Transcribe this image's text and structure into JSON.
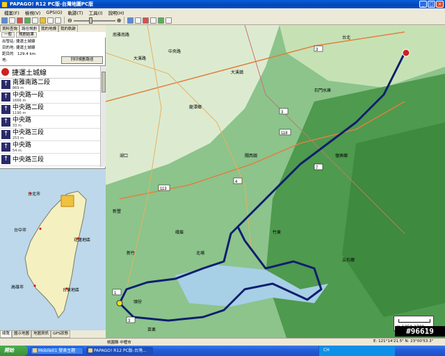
{
  "window": {
    "title": "PAPAGO! R12 PC版-台灣地圖PC版"
  },
  "menu": [
    "檔案(F)",
    "檢視(V)",
    "GPS(G)",
    "軌跡(T)",
    "工具(I)",
    "說明(H)"
  ],
  "toolbar": {
    "zoom_out_glyph": "⊖",
    "zoom_in_glyph": "⊕"
  },
  "left_tabs": [
    "資料查詢",
    "路徑規劃",
    "我的地標",
    "我的軌跡"
  ],
  "left_subtabs": [
    "一般",
    "規劃結果"
  ],
  "route": {
    "rows": [
      {
        "key": "出發站:",
        "value": "捷運土城線"
      },
      {
        "key": "目的地:",
        "value": "捷運土城線"
      },
      {
        "key": "距目的地:",
        "value": "129.4 km"
      }
    ],
    "print_label": "列印規劃路徑"
  },
  "directions": {
    "head": "捷運土城線",
    "steps": [
      {
        "road": "南雅南路二段",
        "dist": "869 m"
      },
      {
        "road": "中央路一段",
        "dist": "1666 m"
      },
      {
        "road": "中央路二段",
        "dist": "1190 m"
      },
      {
        "road": "中央路",
        "dist": "33 m"
      },
      {
        "road": "中央路三段",
        "dist": "253 m"
      },
      {
        "road": "中央路",
        "dist": "54 m"
      },
      {
        "road": "中央路三段",
        "dist": ""
      }
    ]
  },
  "overview_labels": [
    "台北市",
    "台中市",
    "花蓮地區",
    "高雄市",
    "台東地區"
  ],
  "bottom_tabs": [
    "總覽",
    "圖示地圖",
    "地圖資訊",
    "GPS狀態"
  ],
  "map": {
    "labels": [
      "南雅南路",
      "大溪路",
      "中央路",
      "台北",
      "石門水庫",
      "大溪鎮",
      "復興鄉",
      "關西鎮",
      "龍潭鄉",
      "竹東",
      "北埔",
      "峨眉",
      "新竹",
      "湖口",
      "新豐",
      "苗栗",
      "頭份",
      "尖石鄉"
    ],
    "road_shields": [
      "3",
      "4",
      "7",
      "118",
      "113",
      "3",
      "1",
      "3"
    ],
    "scale_value": "1350",
    "scale_value2": "2700",
    "scale_unit": "m"
  },
  "watermark": "#96619",
  "status": {
    "left": "桃園縣 中壢市",
    "right": "E: 121°14'21.5\"  N: 23°00'53.3\""
  },
  "taskbar": {
    "start": "開始",
    "tasks": [
      "Mobile01 發表主題",
      "PAPAGO! R12 PC版-台灣..."
    ],
    "tray_lang": "CH"
  }
}
